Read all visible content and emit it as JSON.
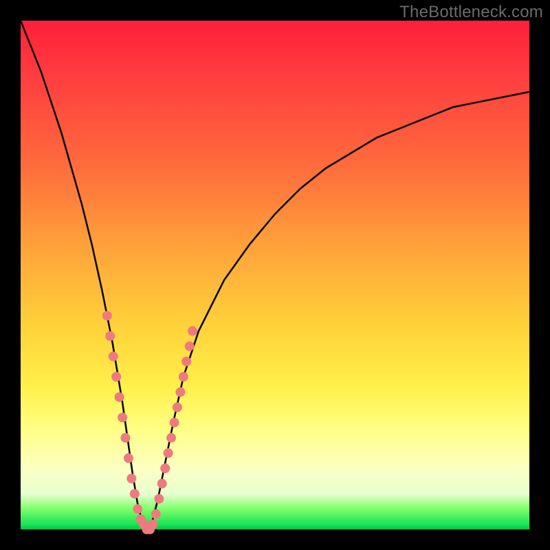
{
  "watermark": "TheBottleneck.com",
  "colors": {
    "frame": "#000000",
    "curve": "#0a0a0a",
    "marker": "#ef7a7e",
    "gradient_top": "#ff1f3a",
    "gradient_bottom": "#00c84a"
  },
  "chart_data": {
    "type": "line",
    "title": "",
    "xlabel": "",
    "ylabel": "",
    "xlim": [
      0,
      100
    ],
    "ylim": [
      0,
      100
    ],
    "grid": false,
    "legend": false,
    "series": [
      {
        "name": "bottleneck-curve",
        "x": [
          0,
          2,
          4,
          6,
          8,
          10,
          12,
          14,
          16,
          18,
          19,
          20,
          21,
          22,
          23,
          24,
          25,
          26,
          27,
          28,
          30,
          32,
          35,
          40,
          45,
          50,
          55,
          60,
          65,
          70,
          75,
          80,
          85,
          90,
          95,
          100
        ],
        "y": [
          100,
          95,
          90,
          84,
          78,
          71,
          64,
          56,
          47,
          37,
          31,
          25,
          18,
          11,
          5,
          1,
          0,
          2,
          6,
          11,
          21,
          30,
          39,
          49,
          56,
          62,
          67,
          71,
          74,
          77,
          79,
          81,
          83,
          84,
          85,
          86
        ]
      }
    ],
    "annotations": {
      "marker_points": [
        {
          "x": 17.0,
          "y": 42
        },
        {
          "x": 17.6,
          "y": 38
        },
        {
          "x": 18.2,
          "y": 34
        },
        {
          "x": 18.8,
          "y": 30
        },
        {
          "x": 19.4,
          "y": 26
        },
        {
          "x": 20.0,
          "y": 22
        },
        {
          "x": 20.6,
          "y": 18
        },
        {
          "x": 21.2,
          "y": 14
        },
        {
          "x": 21.8,
          "y": 10
        },
        {
          "x": 22.4,
          "y": 7
        },
        {
          "x": 23.0,
          "y": 4
        },
        {
          "x": 23.6,
          "y": 2
        },
        {
          "x": 24.2,
          "y": 1
        },
        {
          "x": 24.8,
          "y": 0
        },
        {
          "x": 25.4,
          "y": 0
        },
        {
          "x": 26.0,
          "y": 1
        },
        {
          "x": 26.6,
          "y": 3
        },
        {
          "x": 27.2,
          "y": 6
        },
        {
          "x": 27.8,
          "y": 9
        },
        {
          "x": 28.4,
          "y": 12
        },
        {
          "x": 29.0,
          "y": 15
        },
        {
          "x": 29.6,
          "y": 18
        },
        {
          "x": 30.2,
          "y": 21
        },
        {
          "x": 30.8,
          "y": 24
        },
        {
          "x": 31.4,
          "y": 27
        },
        {
          "x": 32.0,
          "y": 30
        },
        {
          "x": 32.6,
          "y": 33
        },
        {
          "x": 33.2,
          "y": 36
        },
        {
          "x": 33.8,
          "y": 39
        }
      ],
      "marker_radius_px": 7
    }
  }
}
